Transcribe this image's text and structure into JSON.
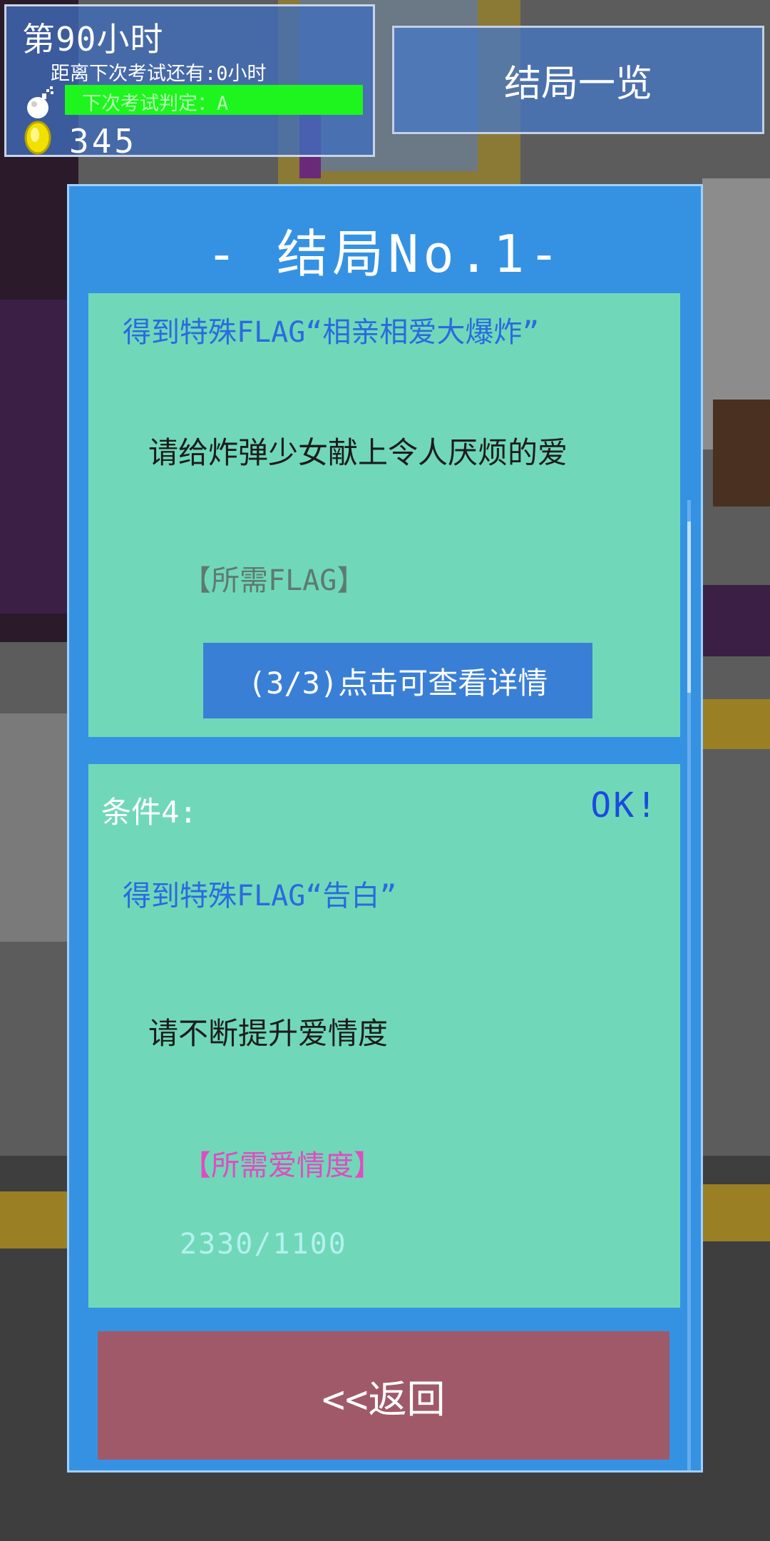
{
  "hud": {
    "hours": "第90小时",
    "next_exam": "距离下次考试还有:0小时",
    "bar_label": "下次考试判定：A",
    "coins": "345",
    "icons": [
      "bomb-icon",
      "coin-icon"
    ]
  },
  "header": {
    "endings_button": "结局一览"
  },
  "dialog": {
    "title": "- 结局No.1-",
    "card1": {
      "flag": "得到特殊FLAG“相亲相爱大爆炸”",
      "hint": "请给炸弹少女献上令人厌烦的爱",
      "requirement_label": "【所需FLAG】",
      "details_button": "(3/3)点击可查看详情"
    },
    "card2": {
      "condition": "条件4:",
      "status": "OK!",
      "flag": "得到特殊FLAG“告白”",
      "hint": "请不断提升爱情度",
      "requirement_label": "【所需爱情度】",
      "progress": "2330/1100"
    },
    "back_button": "<<返回"
  },
  "colors": {
    "dialog_bg": "#3592e3",
    "card_bg": "#70d8b8",
    "flag_text": "#2a6ae0",
    "ok_text": "#1a4ae0",
    "love_label": "#e04cc0",
    "back_button": "#a05968",
    "exam_bar": "#1ef51e"
  }
}
